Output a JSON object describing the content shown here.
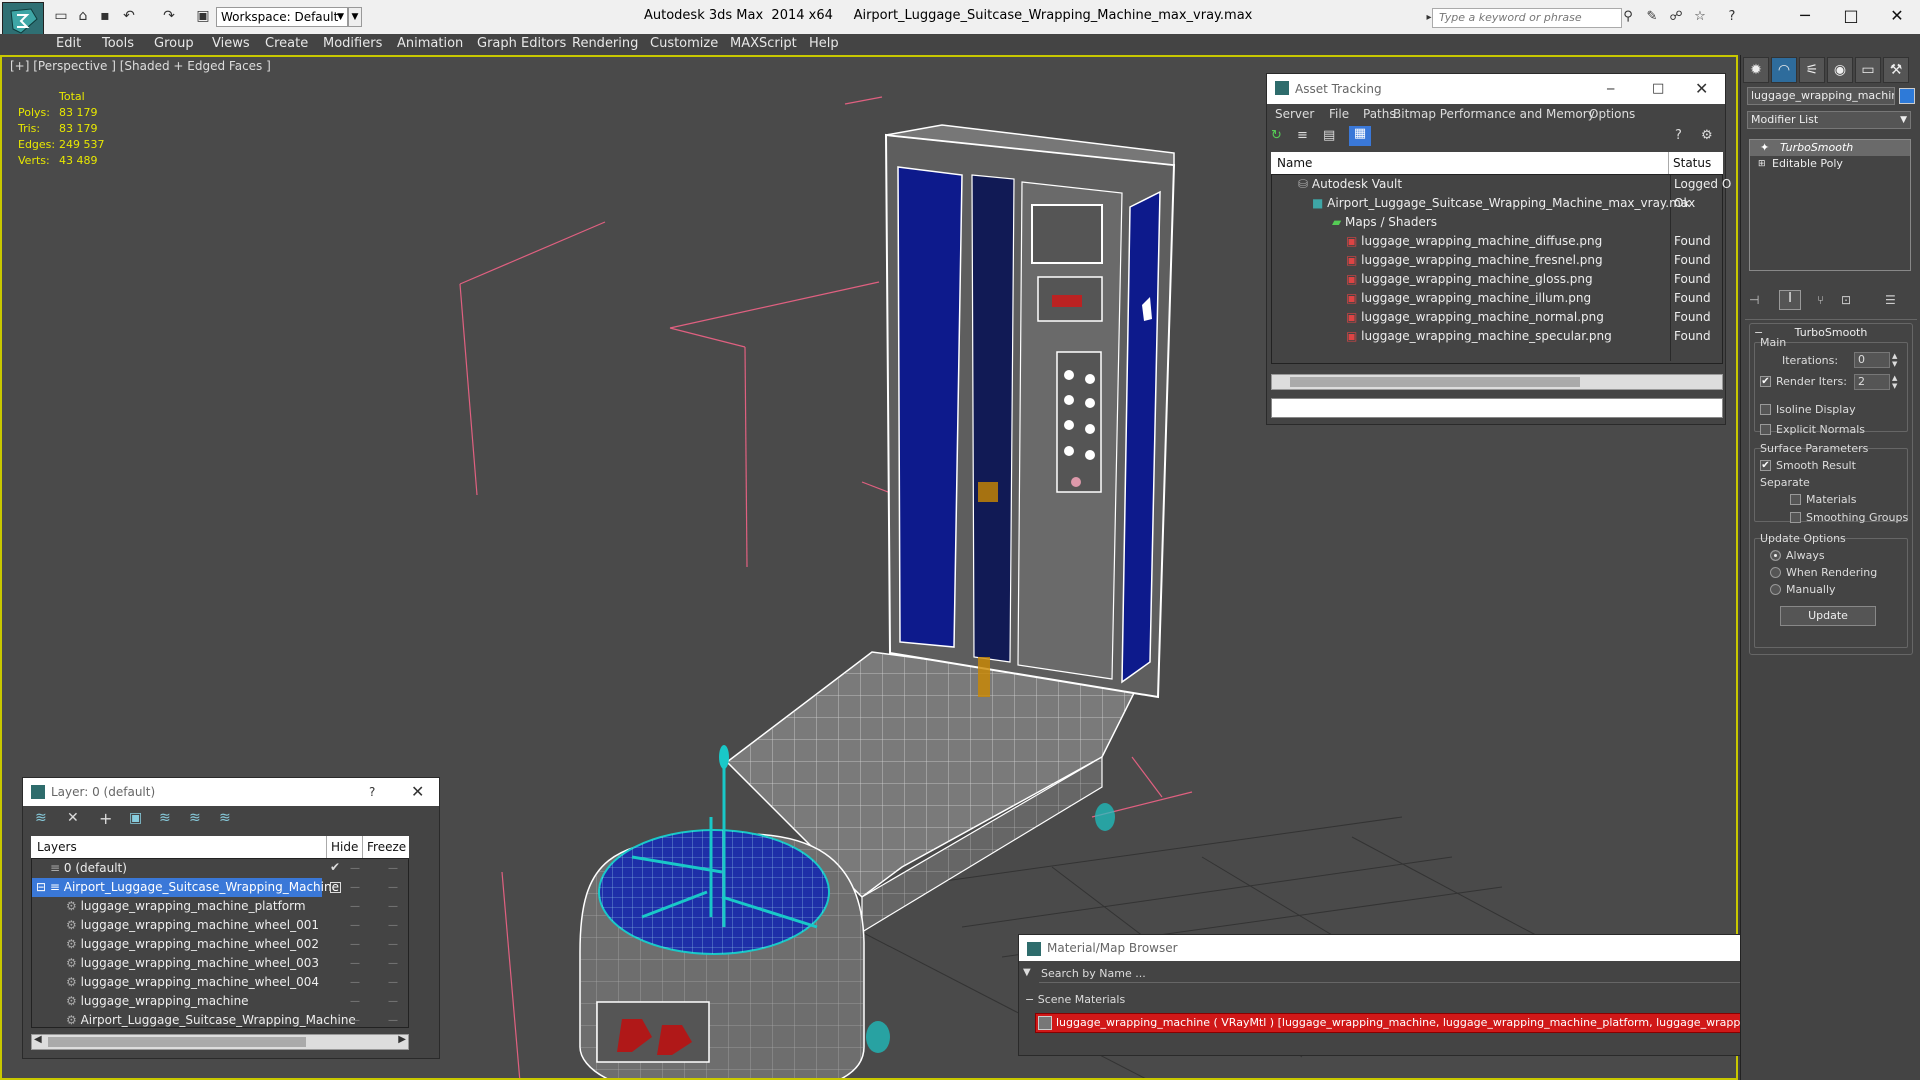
{
  "titlebar": {
    "app_name": "Autodesk 3ds Max  2014 x64",
    "file_name": "Airport_Luggage_Suitcase_Wrapping_Machine_max_vray.max",
    "workspace": "Workspace: Default",
    "search_placeholder": "Type a keyword or phrase"
  },
  "menubar": [
    "Edit",
    "Tools",
    "Group",
    "Views",
    "Create",
    "Modifiers",
    "Animation",
    "Graph Editors",
    "Rendering",
    "Customize",
    "MAXScript",
    "Help"
  ],
  "viewport": {
    "label": "[+] [Perspective ] [Shaded + Edged Faces ]",
    "stats": {
      "header": "Total",
      "rows": [
        {
          "label": "Polys:",
          "value": "83 179"
        },
        {
          "label": "Tris:",
          "value": "83 179"
        },
        {
          "label": "Edges:",
          "value": "249 537"
        },
        {
          "label": "Verts:",
          "value": "43 489"
        }
      ]
    }
  },
  "asset_tracking": {
    "title": "Asset Tracking",
    "menu": [
      "Server",
      "File",
      "Paths",
      "Bitmap Performance and Memory",
      "Options"
    ],
    "columns": [
      "Name",
      "Status"
    ],
    "rows": [
      {
        "name": "Autodesk Vault",
        "status": "Logged O"
      },
      {
        "name": "Airport_Luggage_Suitcase_Wrapping_Machine_max_vray.max",
        "status": "Ok"
      },
      {
        "name": "Maps / Shaders",
        "status": ""
      },
      {
        "name": "luggage_wrapping_machine_diffuse.png",
        "status": "Found"
      },
      {
        "name": "luggage_wrapping_machine_fresnel.png",
        "status": "Found"
      },
      {
        "name": "luggage_wrapping_machine_gloss.png",
        "status": "Found"
      },
      {
        "name": "luggage_wrapping_machine_illum.png",
        "status": "Found"
      },
      {
        "name": "luggage_wrapping_machine_normal.png",
        "status": "Found"
      },
      {
        "name": "luggage_wrapping_machine_specular.png",
        "status": "Found"
      }
    ]
  },
  "layer_panel": {
    "title": "Layer: 0 (default)",
    "help": "?",
    "columns": [
      "Layers",
      "Hide",
      "Freeze"
    ],
    "rows": [
      {
        "name": "0 (default)"
      },
      {
        "name": "Airport_Luggage_Suitcase_Wrapping_Machine"
      },
      {
        "name": "luggage_wrapping_machine_platform"
      },
      {
        "name": "luggage_wrapping_machine_wheel_001"
      },
      {
        "name": "luggage_wrapping_machine_wheel_002"
      },
      {
        "name": "luggage_wrapping_machine_wheel_003"
      },
      {
        "name": "luggage_wrapping_machine_wheel_004"
      },
      {
        "name": "luggage_wrapping_machine"
      },
      {
        "name": "Airport_Luggage_Suitcase_Wrapping_Machine"
      }
    ]
  },
  "material_browser": {
    "title": "Material/Map Browser",
    "search_placeholder": "Search by Name ...",
    "section": "Scene Materials",
    "item": "luggage_wrapping_machine ( VRayMtl ) [luggage_wrapping_machine, luggage_wrapping_machine_platform, luggage_wrapping_machine_wheel_001, luggage_wr..."
  },
  "command_panel": {
    "object_name": "luggage_wrapping_machine",
    "modifier_list": "Modifier List",
    "stack": [
      "TurboSmooth",
      "Editable Poly"
    ],
    "rollout_title": "TurboSmooth",
    "main_label": "Main",
    "iterations_label": "Iterations:",
    "iterations_value": "0",
    "render_iters_label": "Render Iters:",
    "render_iters_value": "2",
    "isoline_label": "Isoline Display",
    "explicit_label": "Explicit Normals",
    "surface_label": "Surface Parameters",
    "smooth_label": "Smooth Result",
    "separate_label": "Separate",
    "materials_label": "Materials",
    "smoothing_groups_label": "Smoothing Groups",
    "update_options_label": "Update Options",
    "always_label": "Always",
    "when_rendering_label": "When Rendering",
    "manually_label": "Manually",
    "update_button": "Update"
  },
  "colors": {
    "accent": "#2e6c6c",
    "selection": "#3a78d8",
    "wire_cyan": "#19c8c8",
    "panel_blue": "#0d1a8c"
  }
}
